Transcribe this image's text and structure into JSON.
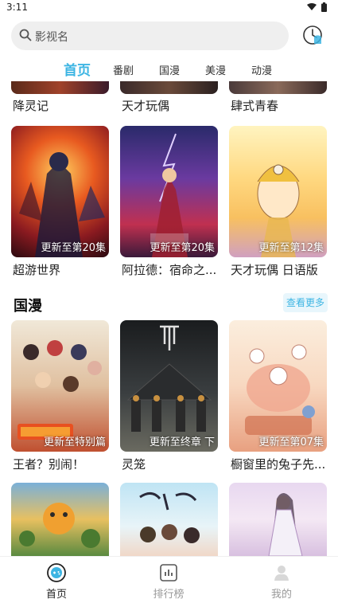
{
  "status_bar": {
    "time": "3:11"
  },
  "search": {
    "placeholder": "影视名"
  },
  "tabs": [
    {
      "label": "首页",
      "active": true
    },
    {
      "label": "番剧",
      "active": false
    },
    {
      "label": "国漫",
      "active": false
    },
    {
      "label": "美漫",
      "active": false
    },
    {
      "label": "动漫",
      "active": false
    }
  ],
  "section_top": {
    "items": [
      {
        "title": "降灵记"
      },
      {
        "title": "天才玩偶"
      },
      {
        "title": "肆式青春"
      },
      {
        "title": "超游世界",
        "badge": "更新至第20集"
      },
      {
        "title": "阿拉德：宿命之...",
        "badge": "更新至第20集"
      },
      {
        "title": "天才玩偶 日语版",
        "badge": "更新至第12集"
      }
    ]
  },
  "section_guoman": {
    "title": "国漫",
    "more_label": "查看更多",
    "items": [
      {
        "title": "王者？别闹！",
        "badge": "更新至特别篇"
      },
      {
        "title": "灵笼",
        "badge": "更新至终章 下"
      },
      {
        "title": "橱窗里的兔子先...",
        "badge": "更新至第07集"
      },
      {
        "title": ""
      },
      {
        "title": ""
      },
      {
        "title": ""
      }
    ]
  },
  "bottom_nav": [
    {
      "label": "首页",
      "icon": "gamepad-icon",
      "active": true
    },
    {
      "label": "排行榜",
      "icon": "chart-icon",
      "active": false
    },
    {
      "label": "我的",
      "icon": "user-icon",
      "active": false
    }
  ],
  "colors": {
    "accent": "#3db5e3"
  }
}
